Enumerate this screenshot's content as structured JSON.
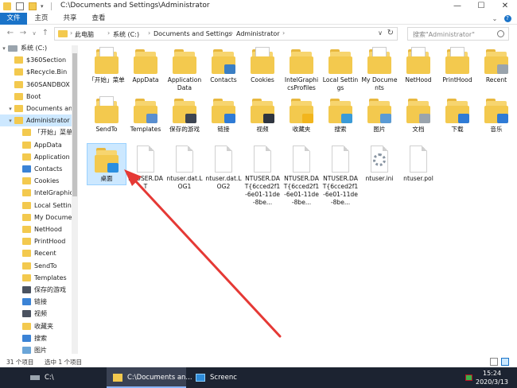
{
  "window": {
    "title": "C:\\Documents and Settings\\Administrator",
    "min": "—",
    "max": "☐",
    "close": "✕"
  },
  "ribbon": {
    "tabs": [
      "文件",
      "主页",
      "共享",
      "查看"
    ],
    "expand_icon": "chevron-down-icon",
    "help_icon": "help-icon"
  },
  "address": {
    "crumbs": [
      "此电脑",
      "系统 (C:)",
      "Documents and Settings",
      "Administrator"
    ],
    "search_placeholder": "搜索\"Administrator\""
  },
  "navpane": {
    "items": [
      {
        "label": "系统 (C:)",
        "icon": "drive-icon",
        "level": 0,
        "arrow": "v"
      },
      {
        "label": "$360Section",
        "icon": "folder-icon",
        "level": 1
      },
      {
        "label": "$Recycle.Bin",
        "icon": "folder-icon",
        "level": 1
      },
      {
        "label": "360SANDBOX",
        "icon": "folder-icon",
        "level": 1
      },
      {
        "label": "Boot",
        "icon": "folder-icon",
        "level": 1
      },
      {
        "label": "Documents and Settings",
        "icon": "folder-icon",
        "level": 1,
        "arrow": "v"
      },
      {
        "label": "Administrator",
        "icon": "folder-icon",
        "level": 2,
        "selected": true,
        "arrow": "v"
      },
      {
        "label": "「开始」菜单",
        "icon": "folder-icon",
        "level": 3
      },
      {
        "label": "AppData",
        "icon": "folder-icon",
        "level": 3
      },
      {
        "label": "Application Data",
        "icon": "folder-icon",
        "level": 3
      },
      {
        "label": "Contacts",
        "icon": "contacts-icon",
        "level": 3
      },
      {
        "label": "Cookies",
        "icon": "folder-icon",
        "level": 3
      },
      {
        "label": "IntelGraphicsProfiles",
        "icon": "folder-icon",
        "level": 3
      },
      {
        "label": "Local Settings",
        "icon": "folder-icon",
        "level": 3
      },
      {
        "label": "My Documents",
        "icon": "folder-icon",
        "level": 3
      },
      {
        "label": "NetHood",
        "icon": "folder-icon",
        "level": 3
      },
      {
        "label": "PrintHood",
        "icon": "folder-icon",
        "level": 3
      },
      {
        "label": "Recent",
        "icon": "folder-icon",
        "level": 3
      },
      {
        "label": "SendTo",
        "icon": "folder-icon",
        "level": 3
      },
      {
        "label": "Templates",
        "icon": "folder-icon",
        "level": 3
      },
      {
        "label": "保存的游戏",
        "icon": "saved-games-icon",
        "level": 3
      },
      {
        "label": "链接",
        "icon": "links-icon",
        "level": 3
      },
      {
        "label": "视频",
        "icon": "videos-icon",
        "level": 3
      },
      {
        "label": "收藏夹",
        "icon": "favorites-icon",
        "level": 3
      },
      {
        "label": "搜索",
        "icon": "search-folder-icon",
        "level": 3
      },
      {
        "label": "图片",
        "icon": "pictures-icon",
        "level": 3
      }
    ]
  },
  "files": [
    {
      "name": "「开始」菜单",
      "icon": "folder-docs-icon"
    },
    {
      "name": "AppData",
      "icon": "folder-icon"
    },
    {
      "name": "Application Data",
      "icon": "folder-icon"
    },
    {
      "name": "Contacts",
      "icon": "contacts-icon"
    },
    {
      "name": "Cookies",
      "icon": "folder-docs-icon"
    },
    {
      "name": "IntelGraphicsProfiles",
      "icon": "folder-icon"
    },
    {
      "name": "Local Settings",
      "icon": "folder-icon"
    },
    {
      "name": "My Documents",
      "icon": "folder-docs-icon"
    },
    {
      "name": "NetHood",
      "icon": "folder-docs-icon"
    },
    {
      "name": "PrintHood",
      "icon": "folder-docs-icon"
    },
    {
      "name": "Recent",
      "icon": "recent-icon"
    },
    {
      "name": "SendTo",
      "icon": "folder-docs-icon"
    },
    {
      "name": "Templates",
      "icon": "templates-icon"
    },
    {
      "name": "保存的游戏",
      "icon": "saved-games-icon"
    },
    {
      "name": "链接",
      "icon": "links-icon"
    },
    {
      "name": "视频",
      "icon": "videos-icon"
    },
    {
      "name": "收藏夹",
      "icon": "favorites-icon"
    },
    {
      "name": "搜索",
      "icon": "search-folder-icon"
    },
    {
      "name": "图片",
      "icon": "pictures-icon"
    },
    {
      "name": "文档",
      "icon": "documents-icon"
    },
    {
      "name": "下载",
      "icon": "downloads-icon"
    },
    {
      "name": "音乐",
      "icon": "music-icon"
    },
    {
      "name": "桌面",
      "icon": "desktop-icon",
      "selected": true
    },
    {
      "name": "NTUSER.DAT",
      "icon": "file-icon"
    },
    {
      "name": "ntuser.dat.LOG1",
      "icon": "file-icon"
    },
    {
      "name": "ntuser.dat.LOG2",
      "icon": "file-icon"
    },
    {
      "name": "NTUSER.DAT{6cced2f1-6e01-11de-8be...",
      "icon": "file-icon"
    },
    {
      "name": "NTUSER.DAT{6cced2f1-6e01-11de-8be...",
      "icon": "file-icon"
    },
    {
      "name": "NTUSER.DAT{6cced2f1-6e01-11de-8be...",
      "icon": "file-icon"
    },
    {
      "name": "ntuser.ini",
      "icon": "settings-file-icon"
    },
    {
      "name": "ntuser.pol",
      "icon": "file-icon"
    }
  ],
  "status": {
    "count": "31 个项目",
    "selected": "选中 1 个项目"
  },
  "taskbar": {
    "drive_label": "C:\\",
    "explorer_label": "C:\\Documents an...",
    "screen_label": "Screenc",
    "time": "15:24",
    "date": "2020/3/13"
  },
  "colors": {
    "accent": "#1a73c8",
    "selection": "#cce8ff",
    "arrow": "#e53935",
    "taskbar": "#1c2331"
  }
}
